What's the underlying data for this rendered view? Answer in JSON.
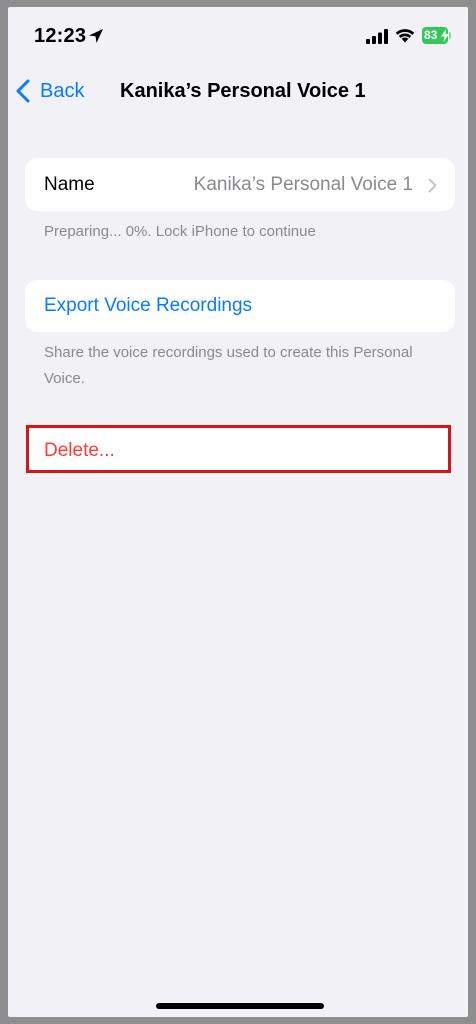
{
  "status_bar": {
    "time": "12:23",
    "battery_level": "83",
    "icons": [
      "location-icon",
      "signal-icon",
      "wifi-icon",
      "battery-icon",
      "charging-bolt-icon"
    ]
  },
  "nav": {
    "back_label": "Back",
    "title": "Kanika’s Personal Voice 1"
  },
  "name_section": {
    "label": "Name",
    "value": "Kanika’s Personal Voice 1",
    "footer": "Preparing... 0%. Lock iPhone to continue"
  },
  "export_section": {
    "label": "Export Voice Recordings",
    "footer": "Share the voice recordings used to create this Personal Voice."
  },
  "delete_section": {
    "label": "Delete..."
  },
  "colors": {
    "accent": "#0a7bff",
    "destructive": "#ff3b30",
    "highlight_border": "#d7141a",
    "background": "#f2f1f6",
    "battery": "#34c759"
  }
}
